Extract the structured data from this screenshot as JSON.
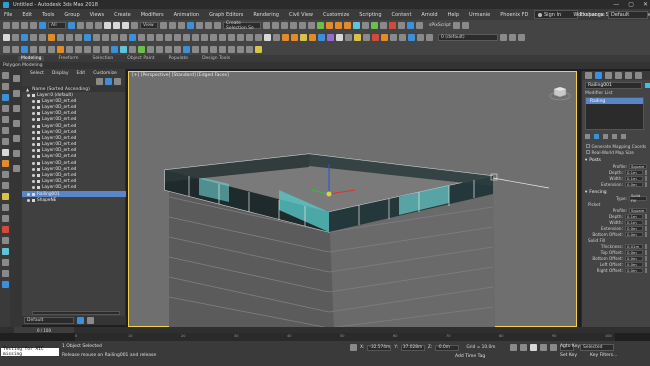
{
  "window": {
    "title": "Untitled - Autodesk 3ds Max 2018",
    "controls": [
      "—",
      "▢",
      "✕"
    ]
  },
  "menu": [
    "File",
    "Edit",
    "Tools",
    "Group",
    "Views",
    "Create",
    "Modifiers",
    "Animation",
    "Graph Editors",
    "Rendering",
    "Civil View",
    "Customize",
    "Scripting",
    "Content",
    "Arnold",
    "Help",
    "Urmanie",
    "Phoenix FD",
    "AKYZ design",
    "Exchange Store",
    "Substance"
  ],
  "signin": "Sign In",
  "workspaces": {
    "label": "Workspaces:",
    "value": "Default"
  },
  "toolbar1": {
    "selection_filter": "All",
    "named_selection": "Create Selection Se",
    "view": "View"
  },
  "toolbar2": {
    "layer": "0 (default)"
  },
  "ribbon": {
    "tabs": [
      "Modeling",
      "Freeform",
      "Selection",
      "Object Paint",
      "Populate",
      "Design Tools"
    ],
    "sub": "Polygon Modeling"
  },
  "explorer": {
    "tabs": [
      "Select",
      "Display",
      "Edit",
      "Customize"
    ],
    "header": "Name (Sorted Ascending)",
    "rows": [
      "Layer:0 (default)",
      "Layer:0D_ert.ed",
      "Layer:0D_ert.ed",
      "Layer:0D_ert.ed",
      "Layer:0D_ert.ed",
      "Layer:0D_ert.ed",
      "Layer:0D_ert.ed",
      "Layer:0D_ert.ed",
      "Layer:0D_ert.ed",
      "Layer:0D_ert.ed",
      "Layer:0D_ert.ed",
      "Layer:0D_ert.ed",
      "Layer:0D_ert.ed",
      "Layer:0D_ert.ed",
      "Layer:0D_ert.ed",
      "Layer:0D_ert.ed",
      "Railing001",
      "ShapeNE"
    ],
    "selected_row_index": 16,
    "footer": "Default"
  },
  "viewport": {
    "label": "[+] [Perspective] [Standard] [Edged Faces]",
    "status": ""
  },
  "command_panel": {
    "object_name": "Railing001",
    "modifier_list": "Modifier List",
    "stack": [
      "Railing"
    ],
    "checks": [
      "Generate Mapping Coords",
      "Real-World Map Size"
    ],
    "posts": {
      "title": "Posts",
      "profile": "Square",
      "depth": "0.1m",
      "width": "0.1m",
      "extension": "0.0m"
    },
    "fencing": {
      "title": "Fencing",
      "type": "Solid Fill",
      "picket_label": "Picket",
      "profile": "Square",
      "depth": "0.1m",
      "width": "0.1m",
      "extension": "0.0m",
      "bottom_offset": "0.0m",
      "solid_fill_label": "Solid Fill",
      "thickness": "0.01m",
      "top_offset": "0.0m",
      "bottom_offset2": "0.0m",
      "left_offset": "0.0m",
      "right_offset": "0.0m"
    }
  },
  "timeslider": "0 / 100",
  "ticks": [
    "0",
    "10",
    "20",
    "30",
    "40",
    "50",
    "60",
    "70",
    "80",
    "90",
    "100"
  ],
  "status": {
    "maxscript": "Testing for AIC missing",
    "line1": "1 Object Selected",
    "line2": "Release mouse on Railing001 and release",
    "x": "-32.574m",
    "y": "37.028m",
    "z": "-0.0m",
    "grid": "Grid = 10.0m",
    "addtime": "Add Time Tag",
    "autokey": "Auto Key",
    "selected": "Selected",
    "setkey": "Set Key",
    "keyfilters": "Key Filters...",
    "frame": "0"
  }
}
